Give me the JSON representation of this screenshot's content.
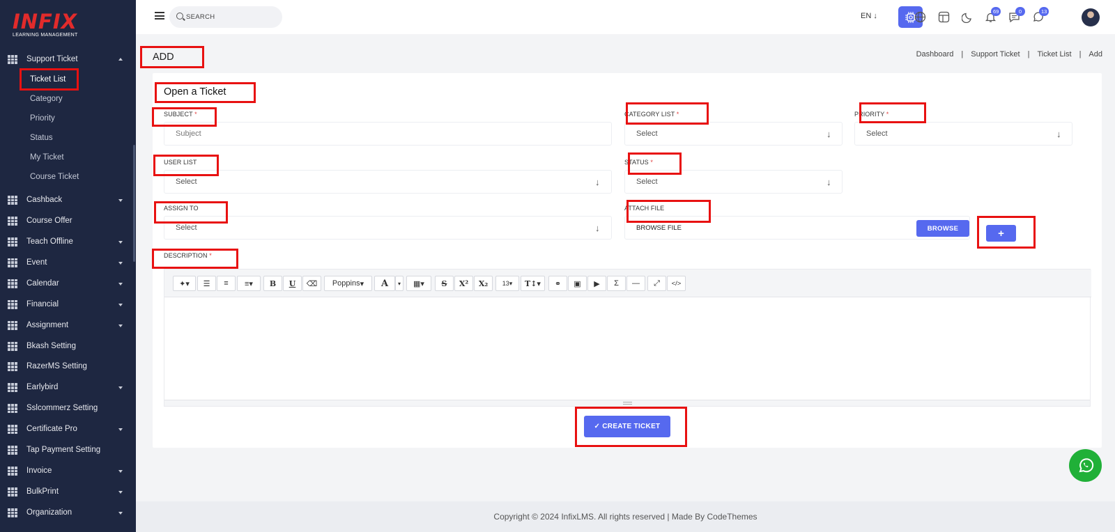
{
  "app": {
    "logo": "INFIX",
    "logo_sub": "LEARNING MANAGEMENT"
  },
  "sidebar": {
    "section": "Support Ticket",
    "subitems": [
      {
        "label": "Ticket List",
        "active": true
      },
      {
        "label": "Category"
      },
      {
        "label": "Priority"
      },
      {
        "label": "Status"
      },
      {
        "label": "My Ticket"
      },
      {
        "label": "Course Ticket"
      }
    ],
    "items": [
      {
        "label": "Cashback",
        "caret": true
      },
      {
        "label": "Course Offer",
        "caret": false
      },
      {
        "label": "Teach Offline",
        "caret": true
      },
      {
        "label": "Event",
        "caret": true
      },
      {
        "label": "Calendar",
        "caret": true
      },
      {
        "label": "Financial",
        "caret": true
      },
      {
        "label": "Assignment",
        "caret": true
      },
      {
        "label": "Bkash Setting",
        "caret": false
      },
      {
        "label": "RazerMS Setting",
        "caret": false
      },
      {
        "label": "Earlybird",
        "caret": true
      },
      {
        "label": "Sslcommerz Setting",
        "caret": false
      },
      {
        "label": "Certificate Pro",
        "caret": true
      },
      {
        "label": "Tap Payment Setting",
        "caret": false
      },
      {
        "label": "Invoice",
        "caret": true
      },
      {
        "label": "BulkPrint",
        "caret": true
      },
      {
        "label": "Organization",
        "caret": true
      }
    ]
  },
  "topbar": {
    "search_placeholder": "SEARCH",
    "language": "EN ↓",
    "badges": {
      "notifications": "69",
      "messages": "0",
      "whatsapp": "13"
    }
  },
  "page": {
    "title": "ADD",
    "breadcrumb": [
      "Dashboard",
      "Support Ticket",
      "Ticket List",
      "Add"
    ]
  },
  "form": {
    "title": "Open a Ticket",
    "required_mark": "*",
    "subject_label": "SUBJECT",
    "subject_placeholder": "Subject",
    "category_label": "CATEGORY LIST",
    "category_value": "Select",
    "priority_label": "PRIORITY",
    "priority_value": "Select",
    "user_label": "USER LIST",
    "user_value": "Select",
    "status_label": "STATUS",
    "status_value": "Select",
    "assign_label": "ASSIGN TO",
    "assign_value": "Select",
    "attach_label": "ATTACH FILE",
    "attach_value": "BROWSE FILE",
    "browse_button": "BROWSE",
    "add_button": "+",
    "description_label": "DESCRIPTION",
    "submit": "✓ CREATE TICKET"
  },
  "editor_toolbar": {
    "font": "Poppins",
    "size": "13",
    "bold": "B",
    "underline": "U",
    "color": "A",
    "strike": "S",
    "sup": "X²",
    "sub": "X₂",
    "sigma": "Σ",
    "code": "</>"
  },
  "footer": {
    "text": "Copyright © 2024 InfixLMS. All rights reserved | Made By CodeThemes"
  },
  "colors": {
    "accent": "#5669ef",
    "sidebar_bg": "#1e2741",
    "highlight": "#e81111",
    "required": "#e24141"
  }
}
